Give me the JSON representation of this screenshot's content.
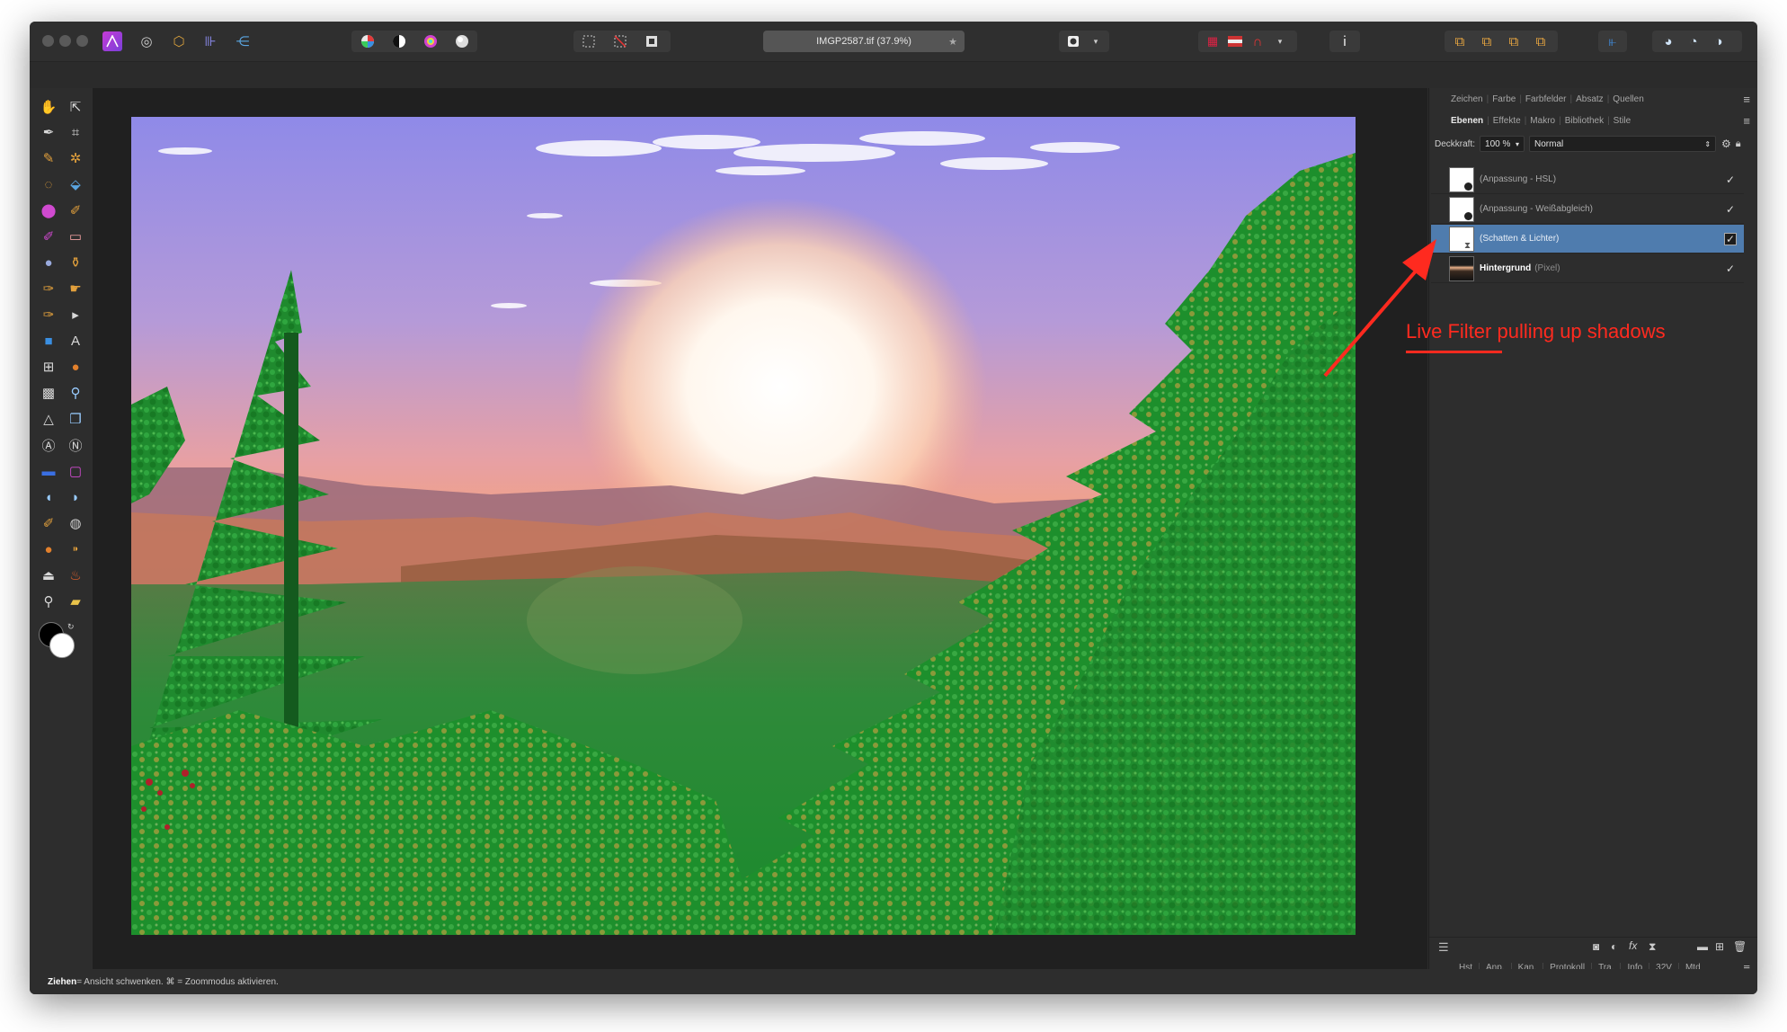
{
  "document": {
    "tab_title": "IMGP2587.tif (37.9%)",
    "tab_star": "★"
  },
  "panel": {
    "top_tabs": [
      "Zeichen",
      "Farbe",
      "Farbfelder",
      "Absatz",
      "Quellen"
    ],
    "layer_tabs": [
      "Ebenen",
      "Effekte",
      "Makro",
      "Bibliothek",
      "Stile"
    ],
    "opacity_label": "Deckkraft:",
    "opacity_value": "100 %",
    "blend_mode": "Normal",
    "layers": [
      {
        "name": "(Anpassung - HSL)",
        "checked": true,
        "selected": false
      },
      {
        "name": "(Anpassung - Weißabgleich)",
        "checked": true,
        "selected": false
      },
      {
        "name": "(Schatten & Lichter)",
        "checked": true,
        "selected": true
      },
      {
        "name": "Hintergrund",
        "suffix": "(Pixel)",
        "checked": true,
        "selected": false
      }
    ],
    "studio_tabs": [
      "Hst",
      "Anp.",
      "Kan.",
      "Protokoll",
      "Tra.",
      "Info",
      "32V",
      "Mtd"
    ]
  },
  "status": {
    "bold": "Ziehen",
    "text": " = Ansicht schwenken. ⌘ = Zoommodus aktivieren."
  },
  "annotation": {
    "text": "Live Filter pulling up shadows",
    "color": "#ff2a1f"
  },
  "colors": {
    "selected_layer": "#4f7cae",
    "window_bg": "#2d2d2d",
    "canvas_bg": "#202020"
  }
}
